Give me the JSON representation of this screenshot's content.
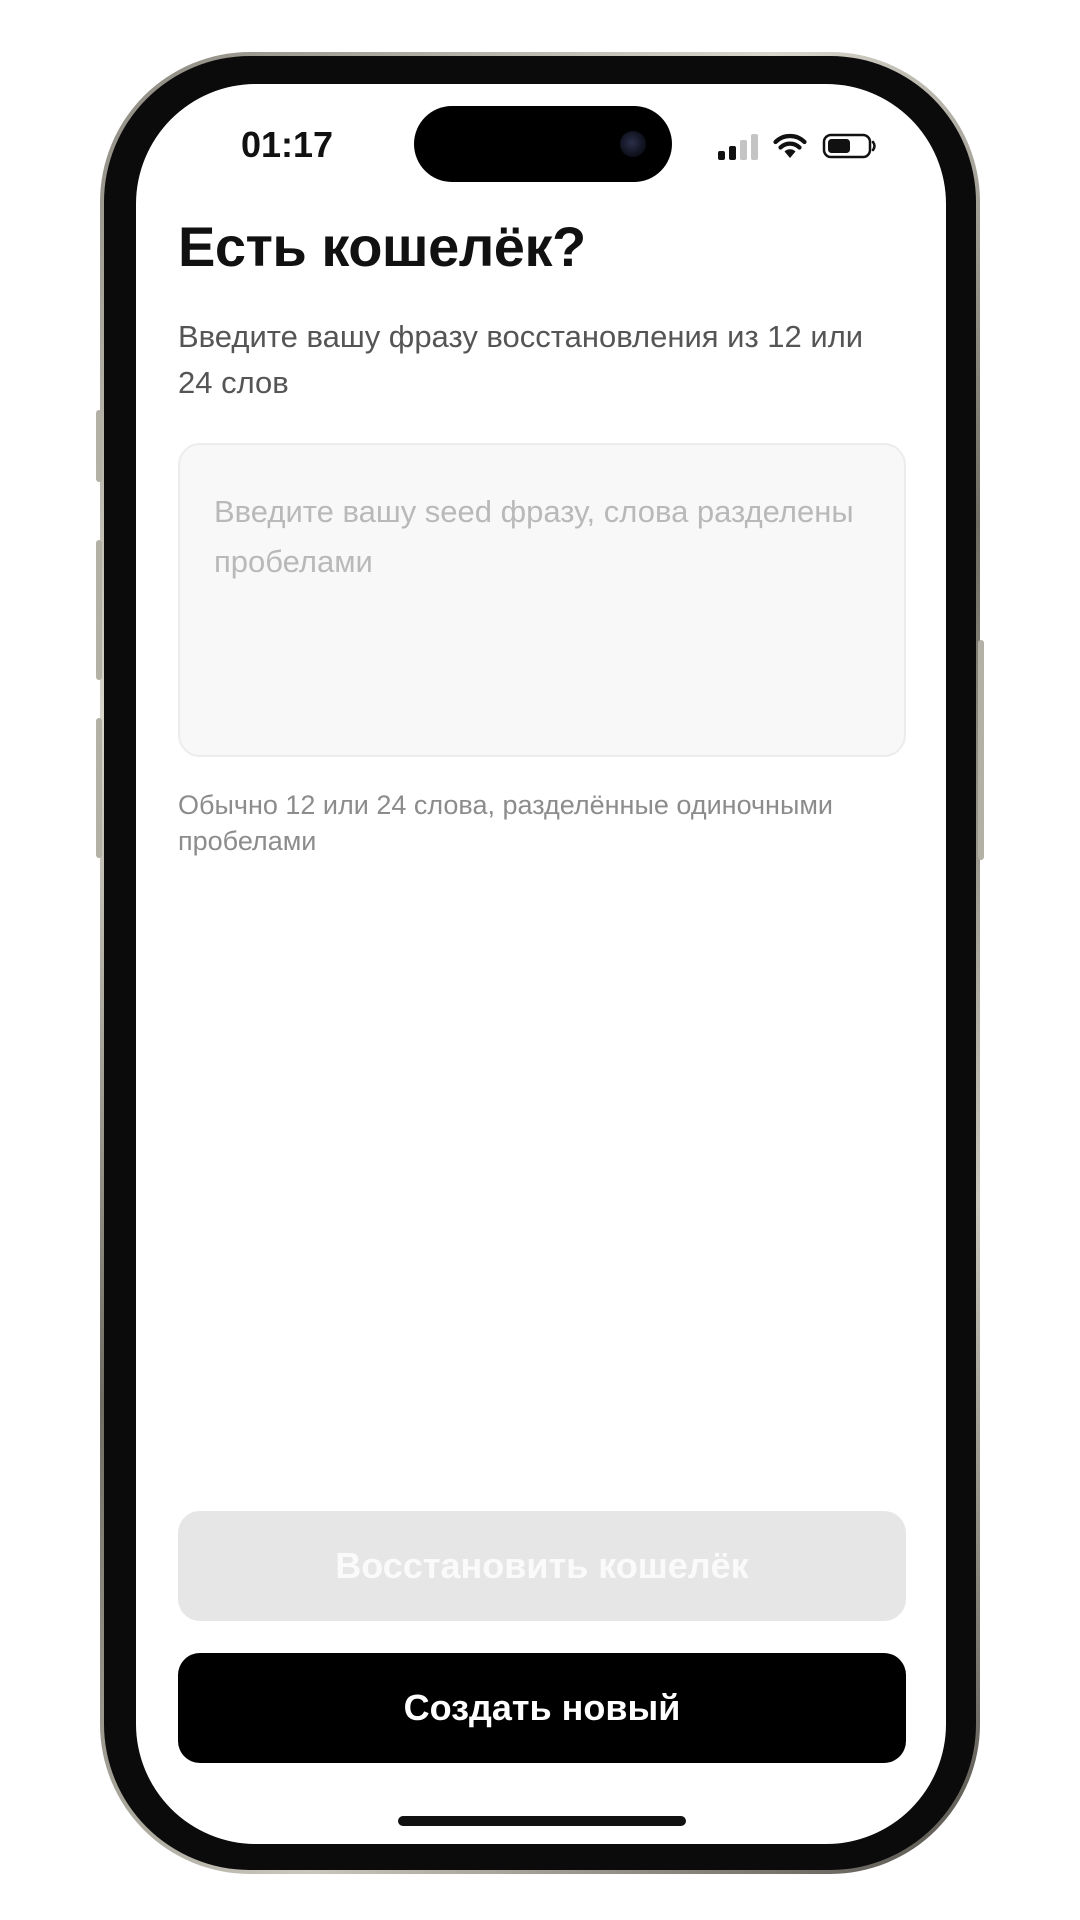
{
  "status_bar": {
    "time": "01:17",
    "signal_icon": "cellular-signal-icon",
    "wifi_icon": "wifi-icon",
    "battery_icon": "battery-icon"
  },
  "screen": {
    "title": "Есть кошелёк?",
    "subtitle": "Введите вашу фразу восстановления из 12 или 24 слов",
    "seed_input": {
      "value": "",
      "placeholder": "Введите вашу seed фразу, слова разделены пробелами"
    },
    "hint": "Обычно 12 или 24 слова, разделённые одиночными пробелами"
  },
  "actions": {
    "restore_label": "Восстановить кошелёк",
    "restore_enabled": false,
    "create_label": "Создать новый"
  },
  "colors": {
    "primary_button": "#000000",
    "disabled_button": "#e6e6e6",
    "background": "#ffffff"
  }
}
